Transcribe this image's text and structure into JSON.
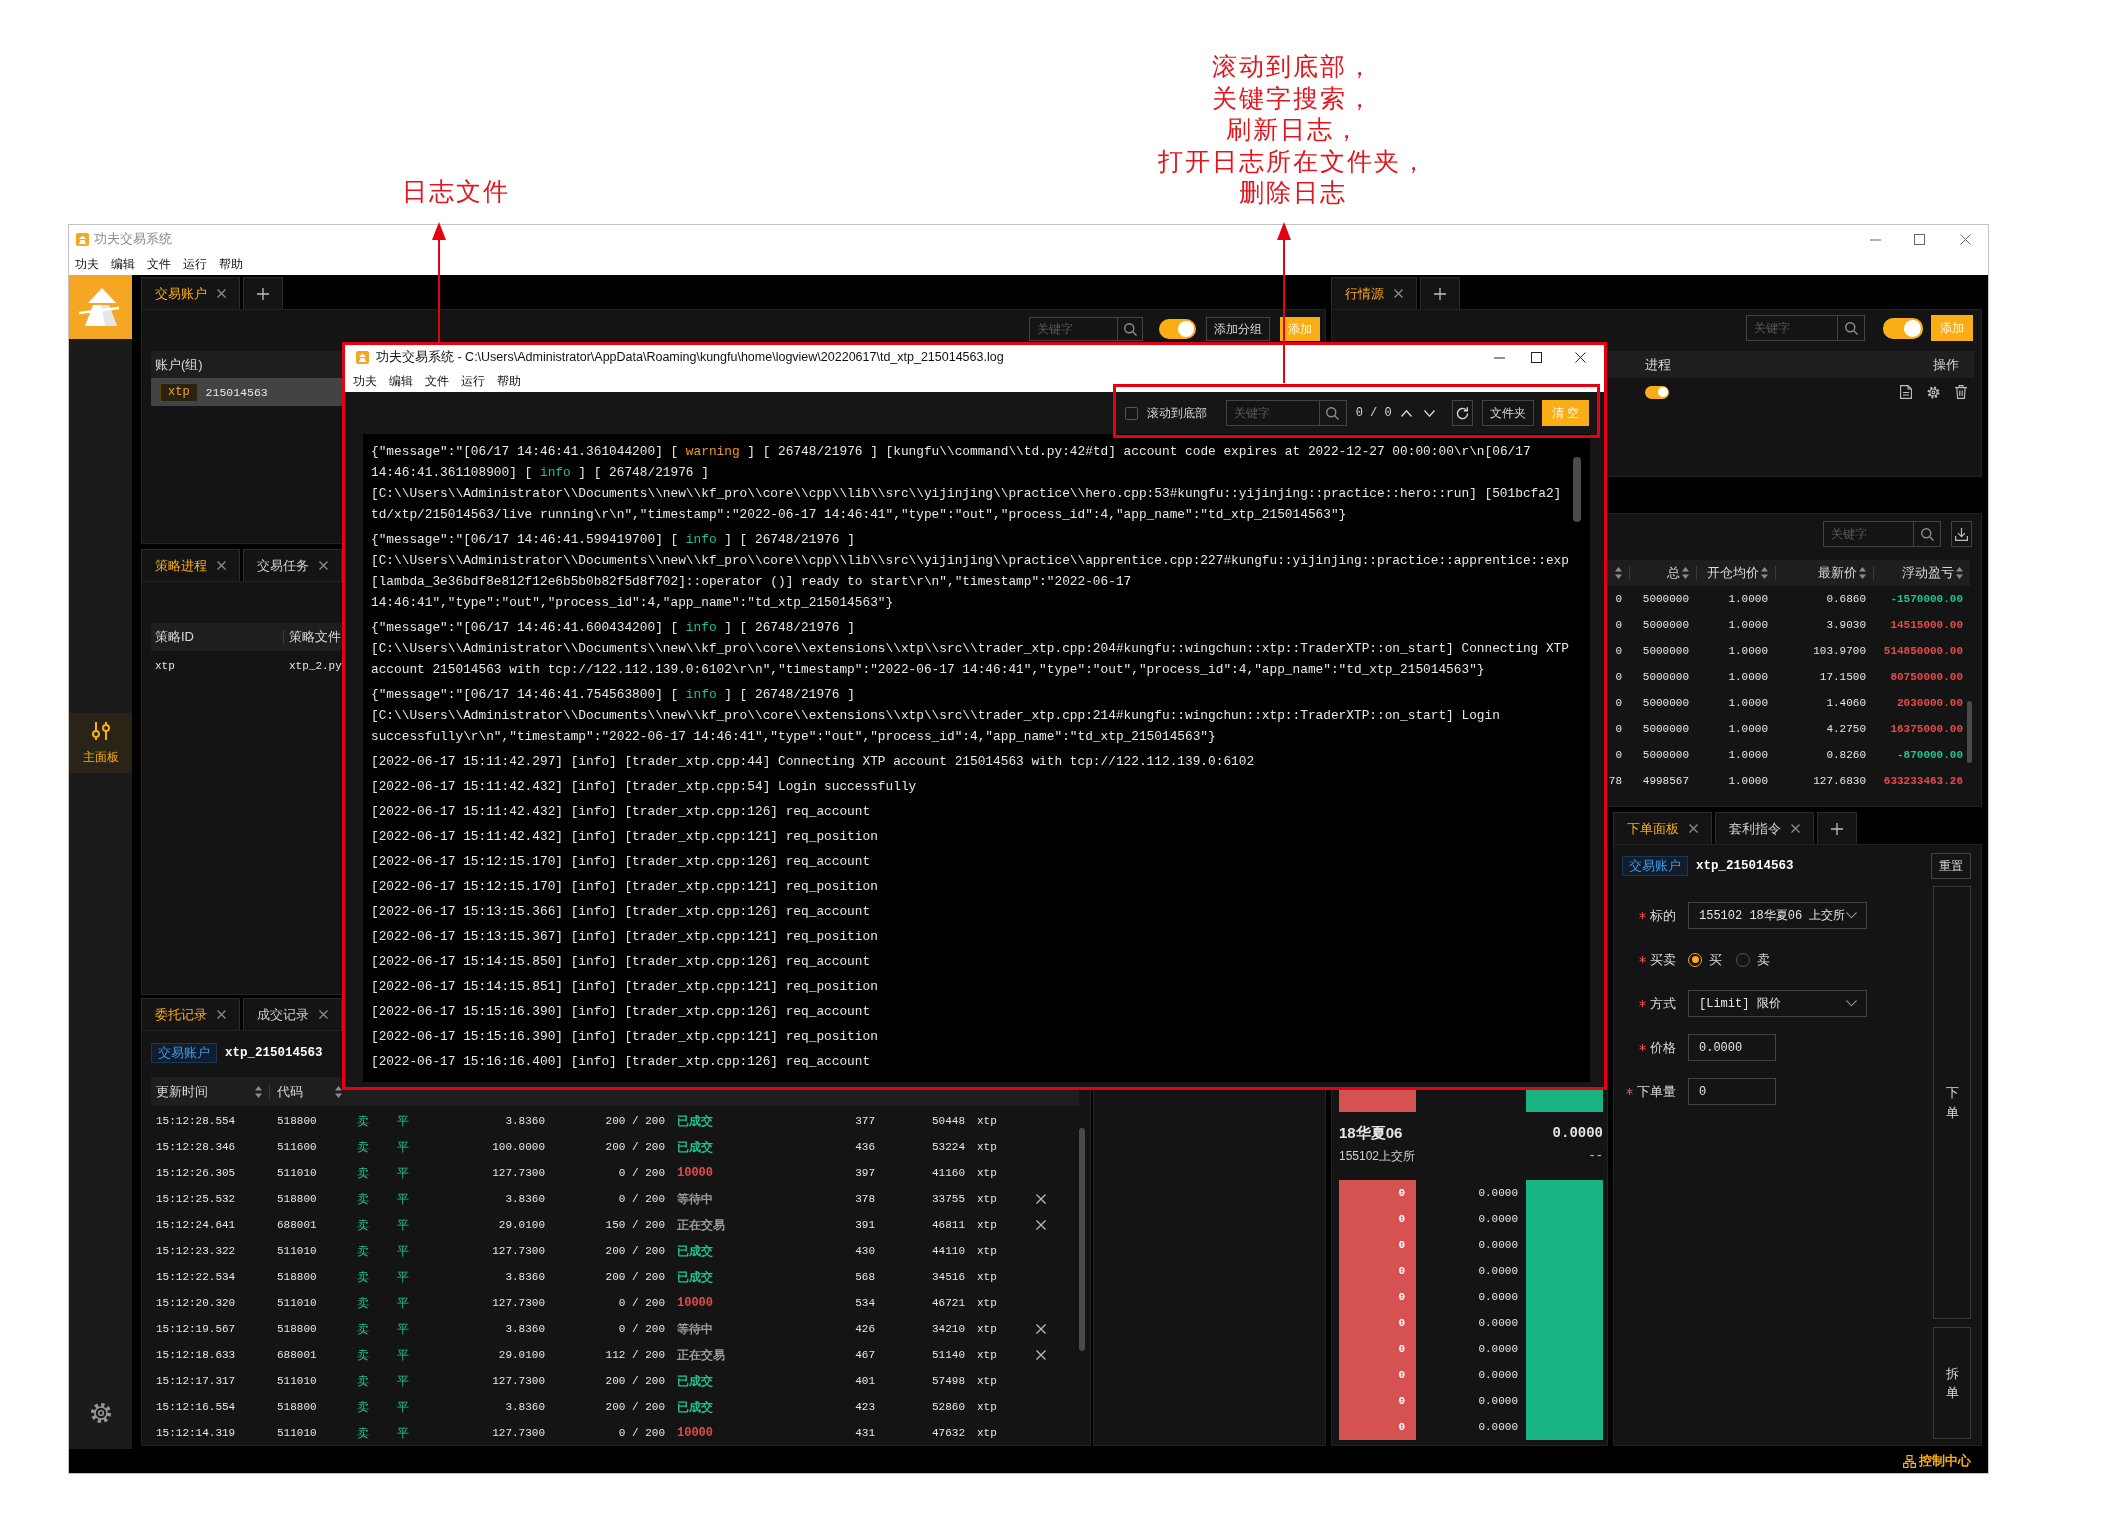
{
  "annotations": [
    {
      "lines": [
        "日志文件"
      ]
    },
    {
      "lines": [
        "滚动到底部，",
        "关键字搜索，",
        "刷新日志，",
        "打开日志所在文件夹，",
        "删除日志"
      ]
    }
  ],
  "window": {
    "title": "功夫交易系统",
    "menu": [
      "功夫",
      "编辑",
      "文件",
      "运行",
      "帮助"
    ]
  },
  "sidebar": {
    "items": [
      {
        "label": "主面板",
        "selected": true
      }
    ]
  },
  "accounts_panel": {
    "tabs": [
      {
        "label": "交易账户",
        "selected": true,
        "closable": true
      }
    ],
    "add_tab": true,
    "search": {
      "placeholder": "关键字"
    },
    "toggle": {
      "on": true
    },
    "buttons": [
      {
        "label": "添加分组",
        "kind": "default"
      },
      {
        "label": "添加",
        "kind": "primary"
      }
    ],
    "table": {
      "columns": [
        {
          "label": "账户(组)"
        }
      ],
      "rows": [
        {
          "tag": "xtp",
          "account": "215014563",
          "selected": true
        }
      ]
    }
  },
  "market_panel": {
    "tabs": [
      {
        "label": "行情源",
        "selected": true,
        "closable": true
      }
    ],
    "add_tab": true,
    "search": {
      "placeholder": "关键字"
    },
    "toggle": {
      "on": true
    },
    "buttons": [
      {
        "label": "添加",
        "kind": "primary"
      }
    ],
    "table": {
      "columns": [
        {
          "label": "进程"
        },
        {
          "label": "操作"
        }
      ],
      "rows": [
        {
          "on": true
        }
      ]
    }
  },
  "strategy_panel": {
    "tabs": [
      {
        "label": "策略进程",
        "selected": true,
        "closable": true
      },
      {
        "label": "交易任务",
        "selected": false,
        "closable": true
      }
    ],
    "table": {
      "columns": [
        {
          "label": "策略ID"
        },
        {
          "label": "策略文件"
        }
      ],
      "rows": [
        {
          "cells": [
            "xtp",
            "xtp_2.py"
          ]
        }
      ]
    }
  },
  "positions_panel": {
    "search": {
      "placeholder": "关键字"
    },
    "table": {
      "columns": [
        {
          "sortable": true
        },
        {
          "label": "总",
          "sortable": true
        },
        {
          "label": "开仓均价",
          "sortable": true
        },
        {
          "label": "最新价",
          "sortable": true
        },
        {
          "label": "浮动盈亏",
          "sortable": true
        }
      ],
      "rows": [
        {
          "cells": [
            "0",
            "5000000",
            "1.0000",
            "0.6860",
            "-1570000.00"
          ],
          "color": "#1ec38e"
        },
        {
          "cells": [
            "0",
            "5000000",
            "1.0000",
            "3.9030",
            "14515000.00"
          ],
          "color": "#e8484a"
        },
        {
          "cells": [
            "0",
            "5000000",
            "1.0000",
            "103.9700",
            "514850000.00"
          ],
          "color": "#e8484a"
        },
        {
          "cells": [
            "0",
            "5000000",
            "1.0000",
            "17.1500",
            "80750000.00"
          ],
          "color": "#e8484a"
        },
        {
          "cells": [
            "0",
            "5000000",
            "1.0000",
            "1.4060",
            "2030000.00"
          ],
          "color": "#e8484a"
        },
        {
          "cells": [
            "0",
            "5000000",
            "1.0000",
            "4.2750",
            "16375000.00"
          ],
          "color": "#e8484a"
        },
        {
          "cells": [
            "0",
            "5000000",
            "1.0000",
            "0.8260",
            "-870000.00"
          ],
          "color": "#1ec38e"
        },
        {
          "cells": [
            "78",
            "4998567",
            "1.0000",
            "127.6830",
            "633233463.26"
          ],
          "color": "#e8484a"
        }
      ]
    }
  },
  "orders_panel": {
    "tabs": [
      {
        "label": "委托记录",
        "selected": true,
        "closable": true
      },
      {
        "label": "成交记录",
        "selected": false,
        "closable": true
      }
    ],
    "account": {
      "tag": "交易账户",
      "name": "xtp_215014563"
    },
    "table": {
      "columns": [
        {
          "label": "更新时间",
          "sortable": true
        },
        {
          "label": "代码",
          "sortable": true
        }
      ],
      "rows": [
        {
          "cells": [
            "15:12:28.554",
            "518800",
            "卖",
            "平",
            "3.8360",
            "200 / 200",
            "已成交",
            "377",
            "50448",
            "xtp"
          ],
          "color": "#1ec38e",
          "cancelable": false
        },
        {
          "cells": [
            "15:12:28.346",
            "511600",
            "卖",
            "平",
            "100.0000",
            "200 / 200",
            "已成交",
            "436",
            "53224",
            "xtp"
          ],
          "color": "#1ec38e",
          "cancelable": false
        },
        {
          "cells": [
            "15:12:26.305",
            "511010",
            "卖",
            "平",
            "127.7300",
            "0 / 200",
            "10000",
            "397",
            "41160",
            "xtp"
          ],
          "color": "#e8484a",
          "cancelable": false
        },
        {
          "cells": [
            "15:12:25.532",
            "518800",
            "卖",
            "平",
            "3.8360",
            "0 / 200",
            "等待中",
            "378",
            "33755",
            "xtp"
          ],
          "color": "#9a9a9a",
          "cancelable": true
        },
        {
          "cells": [
            "15:12:24.641",
            "688001",
            "卖",
            "平",
            "29.0100",
            "150 / 200",
            "正在交易",
            "391",
            "46811",
            "xtp"
          ],
          "color": "#9a9a9a",
          "cancelable": true
        },
        {
          "cells": [
            "15:12:23.322",
            "511010",
            "卖",
            "平",
            "127.7300",
            "200 / 200",
            "已成交",
            "430",
            "44110",
            "xtp"
          ],
          "color": "#1ec38e",
          "cancelable": false
        },
        {
          "cells": [
            "15:12:22.534",
            "518800",
            "卖",
            "平",
            "3.8360",
            "200 / 200",
            "已成交",
            "568",
            "34516",
            "xtp"
          ],
          "color": "#1ec38e",
          "cancelable": false
        },
        {
          "cells": [
            "15:12:20.320",
            "511010",
            "卖",
            "平",
            "127.7300",
            "0 / 200",
            "10000",
            "534",
            "46721",
            "xtp"
          ],
          "color": "#e8484a",
          "cancelable": false
        },
        {
          "cells": [
            "15:12:19.567",
            "518800",
            "卖",
            "平",
            "3.8360",
            "0 / 200",
            "等待中",
            "426",
            "34210",
            "xtp"
          ],
          "color": "#9a9a9a",
          "cancelable": true
        },
        {
          "cells": [
            "15:12:18.633",
            "688001",
            "卖",
            "平",
            "29.0100",
            "112 / 200",
            "正在交易",
            "467",
            "51140",
            "xtp"
          ],
          "color": "#9a9a9a",
          "cancelable": true
        },
        {
          "cells": [
            "15:12:17.317",
            "511010",
            "卖",
            "平",
            "127.7300",
            "200 / 200",
            "已成交",
            "401",
            "57498",
            "xtp"
          ],
          "color": "#1ec38e",
          "cancelable": false
        },
        {
          "cells": [
            "15:12:16.554",
            "518800",
            "卖",
            "平",
            "3.8360",
            "200 / 200",
            "已成交",
            "423",
            "52860",
            "xtp"
          ],
          "color": "#1ec38e",
          "cancelable": false
        },
        {
          "cells": [
            "15:12:14.319",
            "511010",
            "卖",
            "平",
            "127.7300",
            "0 / 200",
            "10000",
            "431",
            "47632",
            "xtp"
          ],
          "color": "#e8484a",
          "cancelable": false
        }
      ]
    }
  },
  "order_book": {
    "title": "18华夏06",
    "title_value": "0.0000",
    "subtitle": "155102上交所",
    "subtitle_value": "--",
    "levels": [
      {
        "volume": "0",
        "price": "0.0000"
      },
      {
        "volume": "0",
        "price": "0.0000"
      },
      {
        "volume": "0",
        "price": "0.0000"
      },
      {
        "volume": "0",
        "price": "0.0000"
      },
      {
        "volume": "0",
        "price": "0.0000"
      },
      {
        "volume": "0",
        "price": "0.0000"
      },
      {
        "volume": "0",
        "price": "0.0000"
      },
      {
        "volume": "0",
        "price": "0.0000"
      },
      {
        "volume": "0",
        "price": "0.0000"
      },
      {
        "volume": "0",
        "price": "0.0000"
      }
    ]
  },
  "order_form": {
    "tabs": [
      {
        "label": "下单面板",
        "selected": true,
        "closable": true
      },
      {
        "label": "套利指令",
        "selected": false,
        "closable": true
      }
    ],
    "add_tab": true,
    "account": {
      "tag": "交易账户",
      "name": "xtp_215014563"
    },
    "reset": "重置",
    "fields": [
      {
        "kind": "select",
        "label": "标的",
        "required": true,
        "value": "155102 18华夏06 上交所"
      },
      {
        "kind": "radio",
        "label": "买卖",
        "required": true,
        "options": [
          {
            "label": "买",
            "selected": true
          },
          {
            "label": "卖",
            "selected": false
          }
        ]
      },
      {
        "kind": "select",
        "label": "方式",
        "required": true,
        "value": "[Limit] 限价"
      },
      {
        "kind": "input",
        "label": "价格",
        "required": true,
        "value": "0.0000"
      },
      {
        "kind": "input",
        "label": "下单量",
        "required": true,
        "value": "0"
      }
    ],
    "actions": [
      {
        "label": "下单"
      },
      {
        "label": "拆单"
      }
    ]
  },
  "status_bar": {
    "label": "控制中心"
  },
  "log_window": {
    "title": "功夫交易系统 - C:\\Users\\Administrator\\AppData\\Roaming\\kungfu\\home\\logview\\20220617\\td_xtp_215014563.log",
    "menu": [
      "功夫",
      "编辑",
      "文件",
      "运行",
      "帮助"
    ],
    "toolbar": {
      "scroll_to_bottom": {
        "label": "滚动到底部",
        "checked": false
      },
      "search": {
        "placeholder": "关键字"
      },
      "match_count": "0 / 0",
      "buttons": [
        {
          "label": "文件夹",
          "kind": "default"
        },
        {
          "label": "清 空",
          "kind": "primary"
        }
      ]
    },
    "entries": [
      {
        "lines": [
          [
            {
              "kind": "plain",
              "text": "{\"message\":\"[06/17 14:46:41.361044200] [ "
            },
            {
              "kind": "warning",
              "text": "warning"
            },
            {
              "kind": "plain",
              "text": " ] [ 26748/21976 ] [kungfu\\\\command\\\\td.py:42#td] account code expires at 2022-12-27 00:00:00\\r\\n[06/17"
            }
          ],
          [
            {
              "kind": "plain",
              "text": "14:46:41.361108900] [ "
            },
            {
              "kind": "info",
              "text": "info"
            },
            {
              "kind": "plain",
              "text": " ] [ 26748/21976 ]"
            }
          ],
          [
            {
              "kind": "plain",
              "text": "[C:\\\\Users\\\\Administrator\\\\Documents\\\\new\\\\kf_pro\\\\core\\\\cpp\\\\lib\\\\src\\\\yijinjing\\\\practice\\\\hero.cpp:53#kungfu::yijinjing::practice::hero::run] [501bcfa2]"
            }
          ],
          [
            {
              "kind": "plain",
              "text": "td/xtp/215014563/live running\\r\\n\",\"timestamp\":\"2022-06-17 14:46:41\",\"type\":\"out\",\"process_id\":4,\"app_name\":\"td_xtp_215014563\"}"
            }
          ]
        ]
      },
      {
        "lines": [
          [
            {
              "kind": "plain",
              "text": "{\"message\":\"[06/17 14:46:41.599419700] [ "
            },
            {
              "kind": "info",
              "text": "info"
            },
            {
              "kind": "plain",
              "text": " ] [ 26748/21976 ]"
            }
          ],
          [
            {
              "kind": "plain",
              "text": "[C:\\\\Users\\\\Administrator\\\\Documents\\\\new\\\\kf_pro\\\\core\\\\cpp\\\\lib\\\\src\\\\yijinjing\\\\practice\\\\apprentice.cpp:227#kungfu::yijinjing::practice::apprentice::exp"
            }
          ],
          [
            {
              "kind": "plain",
              "text": "[lambda_3e36bdf8e812f12e6b5b0b82f5d8f702]::operator ()] ready to start\\r\\n\",\"timestamp\":\"2022-06-17"
            }
          ],
          [
            {
              "kind": "plain",
              "text": "14:46:41\",\"type\":\"out\",\"process_id\":4,\"app_name\":\"td_xtp_215014563\"}"
            }
          ]
        ]
      },
      {
        "lines": [
          [
            {
              "kind": "plain",
              "text": "{\"message\":\"[06/17 14:46:41.600434200] [ "
            },
            {
              "kind": "info",
              "text": "info"
            },
            {
              "kind": "plain",
              "text": " ] [ 26748/21976 ]"
            }
          ],
          [
            {
              "kind": "plain",
              "text": "[C:\\\\Users\\\\Administrator\\\\Documents\\\\new\\\\kf_pro\\\\core\\\\extensions\\\\xtp\\\\src\\\\trader_xtp.cpp:204#kungfu::wingchun::xtp::TraderXTP::on_start] Connecting XTP"
            }
          ],
          [
            {
              "kind": "plain",
              "text": "account 215014563 with tcp://122.112.139.0:6102\\r\\n\",\"timestamp\":\"2022-06-17 14:46:41\",\"type\":\"out\",\"process_id\":4,\"app_name\":\"td_xtp_215014563\"}"
            }
          ]
        ]
      },
      {
        "lines": [
          [
            {
              "kind": "plain",
              "text": "{\"message\":\"[06/17 14:46:41.754563800] [ "
            },
            {
              "kind": "info",
              "text": "info"
            },
            {
              "kind": "plain",
              "text": " ] [ 26748/21976 ]"
            }
          ],
          [
            {
              "kind": "plain",
              "text": "[C:\\\\Users\\\\Administrator\\\\Documents\\\\new\\\\kf_pro\\\\core\\\\extensions\\\\xtp\\\\src\\\\trader_xtp.cpp:214#kungfu::wingchun::xtp::TraderXTP::on_start] Login"
            }
          ],
          [
            {
              "kind": "plain",
              "text": "successfully\\r\\n\",\"timestamp\":\"2022-06-17 14:46:41\",\"type\":\"out\",\"process_id\":4,\"app_name\":\"td_xtp_215014563\"}"
            }
          ]
        ]
      },
      {
        "lines": [
          [
            {
              "kind": "plain",
              "text": "[2022-06-17 15:11:42.297] [info] [trader_xtp.cpp:44] Connecting XTP account 215014563 with tcp://122.112.139.0:6102"
            }
          ]
        ]
      },
      {
        "lines": [
          [
            {
              "kind": "plain",
              "text": "[2022-06-17 15:11:42.432] [info] [trader_xtp.cpp:54] Login successfully"
            }
          ]
        ]
      },
      {
        "lines": [
          [
            {
              "kind": "plain",
              "text": "[2022-06-17 15:11:42.432] [info] [trader_xtp.cpp:126] req_account"
            }
          ]
        ]
      },
      {
        "lines": [
          [
            {
              "kind": "plain",
              "text": "[2022-06-17 15:11:42.432] [info] [trader_xtp.cpp:121] req_position"
            }
          ]
        ]
      },
      {
        "lines": [
          [
            {
              "kind": "plain",
              "text": "[2022-06-17 15:12:15.170] [info] [trader_xtp.cpp:126] req_account"
            }
          ]
        ]
      },
      {
        "lines": [
          [
            {
              "kind": "plain",
              "text": "[2022-06-17 15:12:15.170] [info] [trader_xtp.cpp:121] req_position"
            }
          ]
        ]
      },
      {
        "lines": [
          [
            {
              "kind": "plain",
              "text": "[2022-06-17 15:13:15.366] [info] [trader_xtp.cpp:126] req_account"
            }
          ]
        ]
      },
      {
        "lines": [
          [
            {
              "kind": "plain",
              "text": "[2022-06-17 15:13:15.367] [info] [trader_xtp.cpp:121] req_position"
            }
          ]
        ]
      },
      {
        "lines": [
          [
            {
              "kind": "plain",
              "text": "[2022-06-17 15:14:15.850] [info] [trader_xtp.cpp:126] req_account"
            }
          ]
        ]
      },
      {
        "lines": [
          [
            {
              "kind": "plain",
              "text": "[2022-06-17 15:14:15.851] [info] [trader_xtp.cpp:121] req_position"
            }
          ]
        ]
      },
      {
        "lines": [
          [
            {
              "kind": "plain",
              "text": "[2022-06-17 15:15:16.390] [info] [trader_xtp.cpp:126] req_account"
            }
          ]
        ]
      },
      {
        "lines": [
          [
            {
              "kind": "plain",
              "text": "[2022-06-17 15:15:16.390] [info] [trader_xtp.cpp:121] req_position"
            }
          ]
        ]
      },
      {
        "lines": [
          [
            {
              "kind": "plain",
              "text": "[2022-06-17 15:16:16.400] [info] [trader_xtp.cpp:126] req_account"
            }
          ]
        ]
      }
    ]
  }
}
